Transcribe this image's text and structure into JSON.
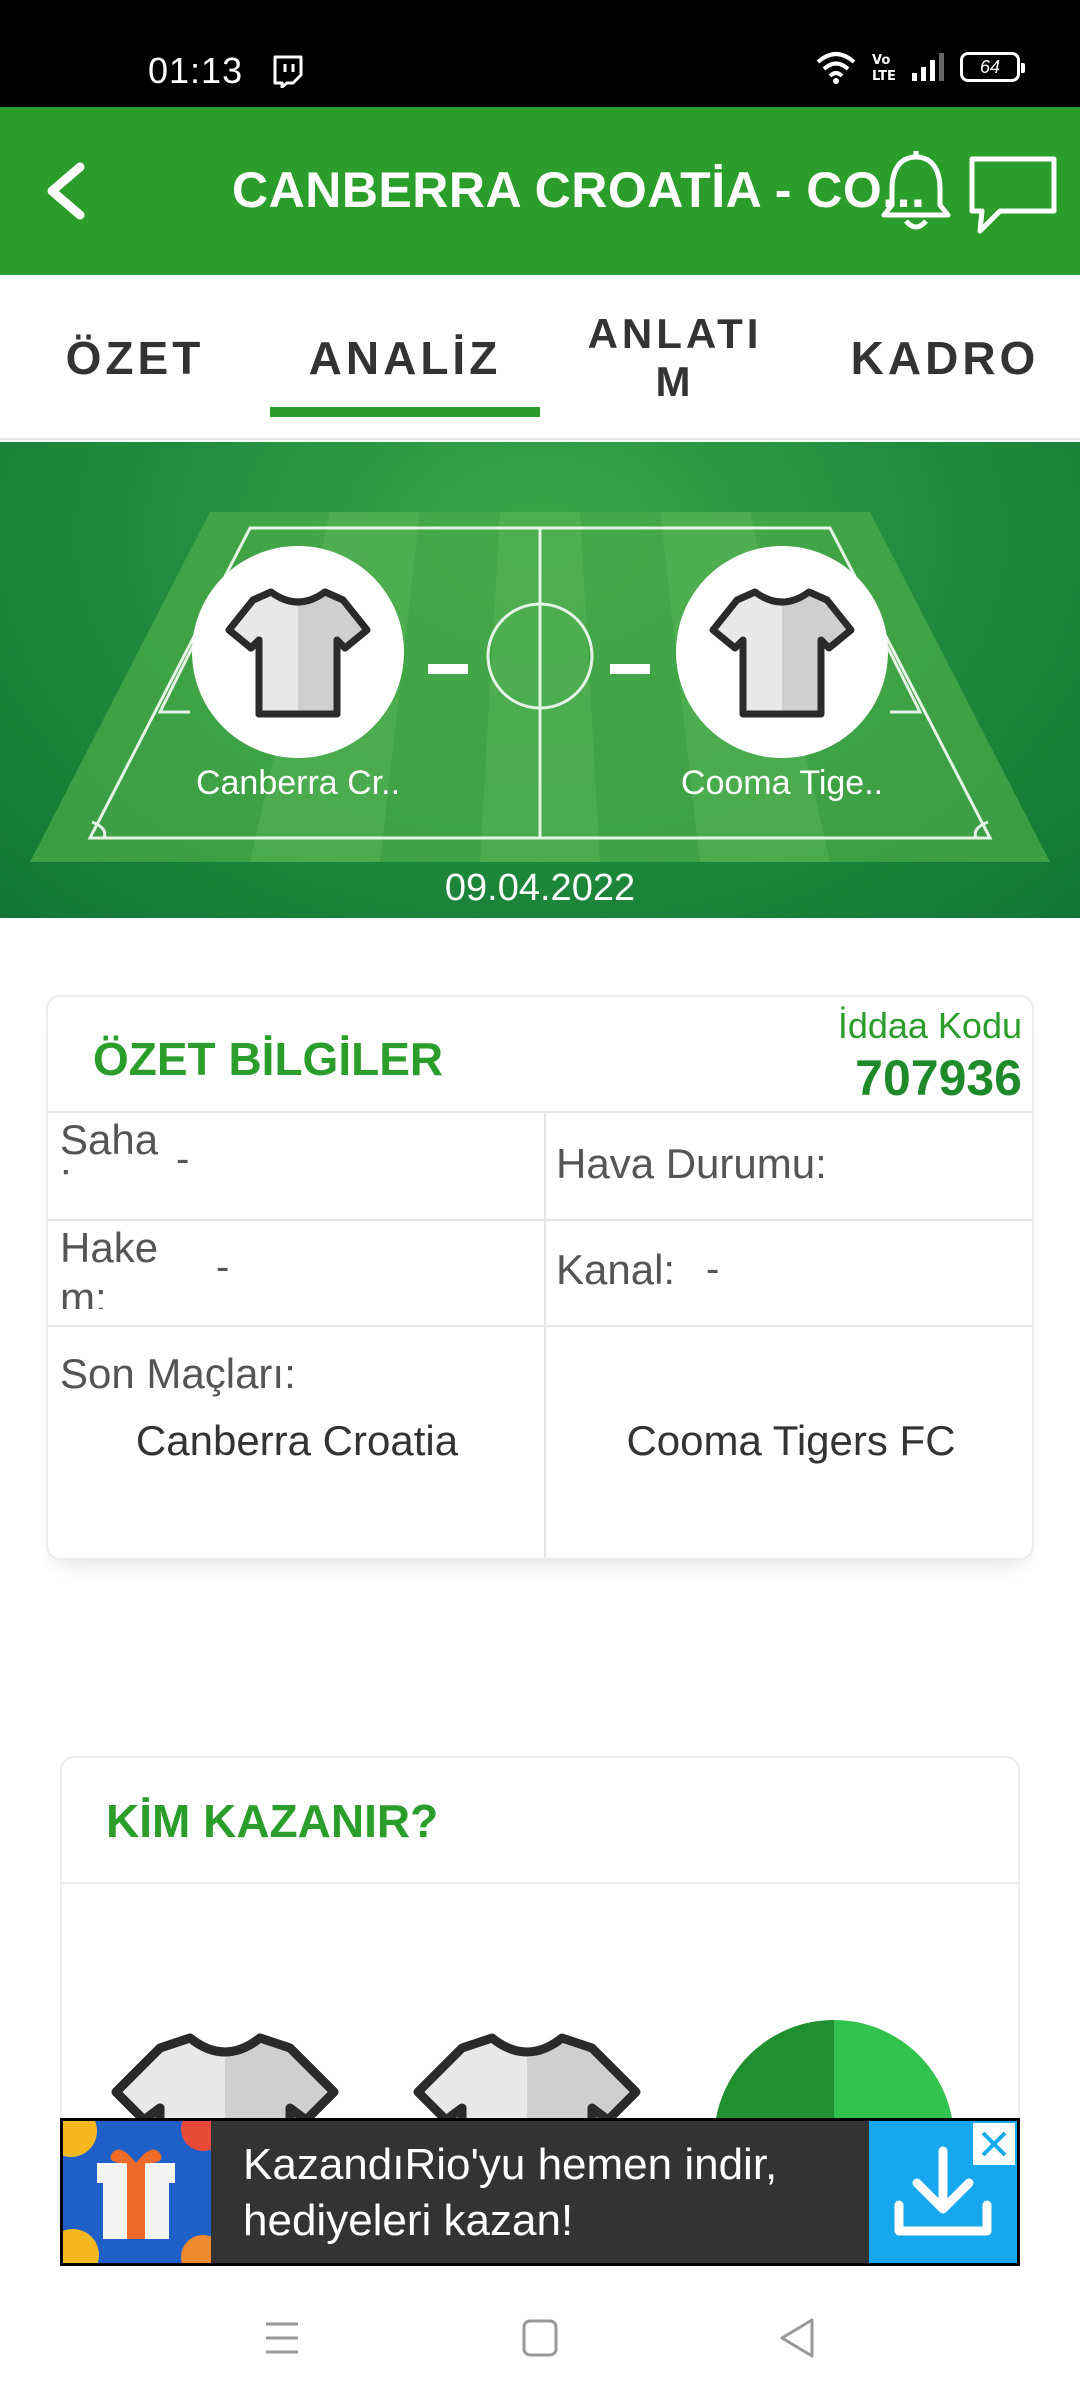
{
  "status": {
    "time": "01:13",
    "battery": "64",
    "icons": [
      "twitch-icon",
      "wifi-icon",
      "volte-icon",
      "signal-icon",
      "battery-icon"
    ]
  },
  "app_bar": {
    "title": "CANBERRA CROATİA - CO...",
    "icons": [
      "back-icon",
      "bell-icon",
      "chat-icon"
    ]
  },
  "tabs": [
    {
      "label": "ÖZET",
      "active": false
    },
    {
      "label": "ANALİZ",
      "active": true
    },
    {
      "label": "ANLATI\nM",
      "active": false
    },
    {
      "label": "KADRO",
      "active": false
    }
  ],
  "match": {
    "home_short": "Canberra Cr..",
    "away_short": "Cooma Tige..",
    "date": "09.04.2022"
  },
  "summary": {
    "title": "ÖZET BİLGİLER",
    "iddaa_label": "İddaa Kodu",
    "iddaa_code": "707936",
    "saha_label_1": "Saha",
    "saha_label_2": ":",
    "saha_value": "-",
    "hava_label": "Hava Durumu:",
    "hava_value": "",
    "hakem_label_1": "Hake",
    "hakem_label_2": "m:",
    "hakem_value": "-",
    "kanal_label": "Kanal:",
    "kanal_value": "-",
    "son_maclari_label": "Son Maçları:",
    "home_team": "Canberra Croatia",
    "away_team": "Cooma Tigers FC"
  },
  "prediction": {
    "title": "KİM KAZANIR?"
  },
  "ad": {
    "line1": "KazandıRio'yu hemen indir,",
    "line2": "hediyeleri kazan!"
  },
  "colors": {
    "brand_green": "#2a9d2a",
    "ad_blue": "#16a7ef"
  }
}
